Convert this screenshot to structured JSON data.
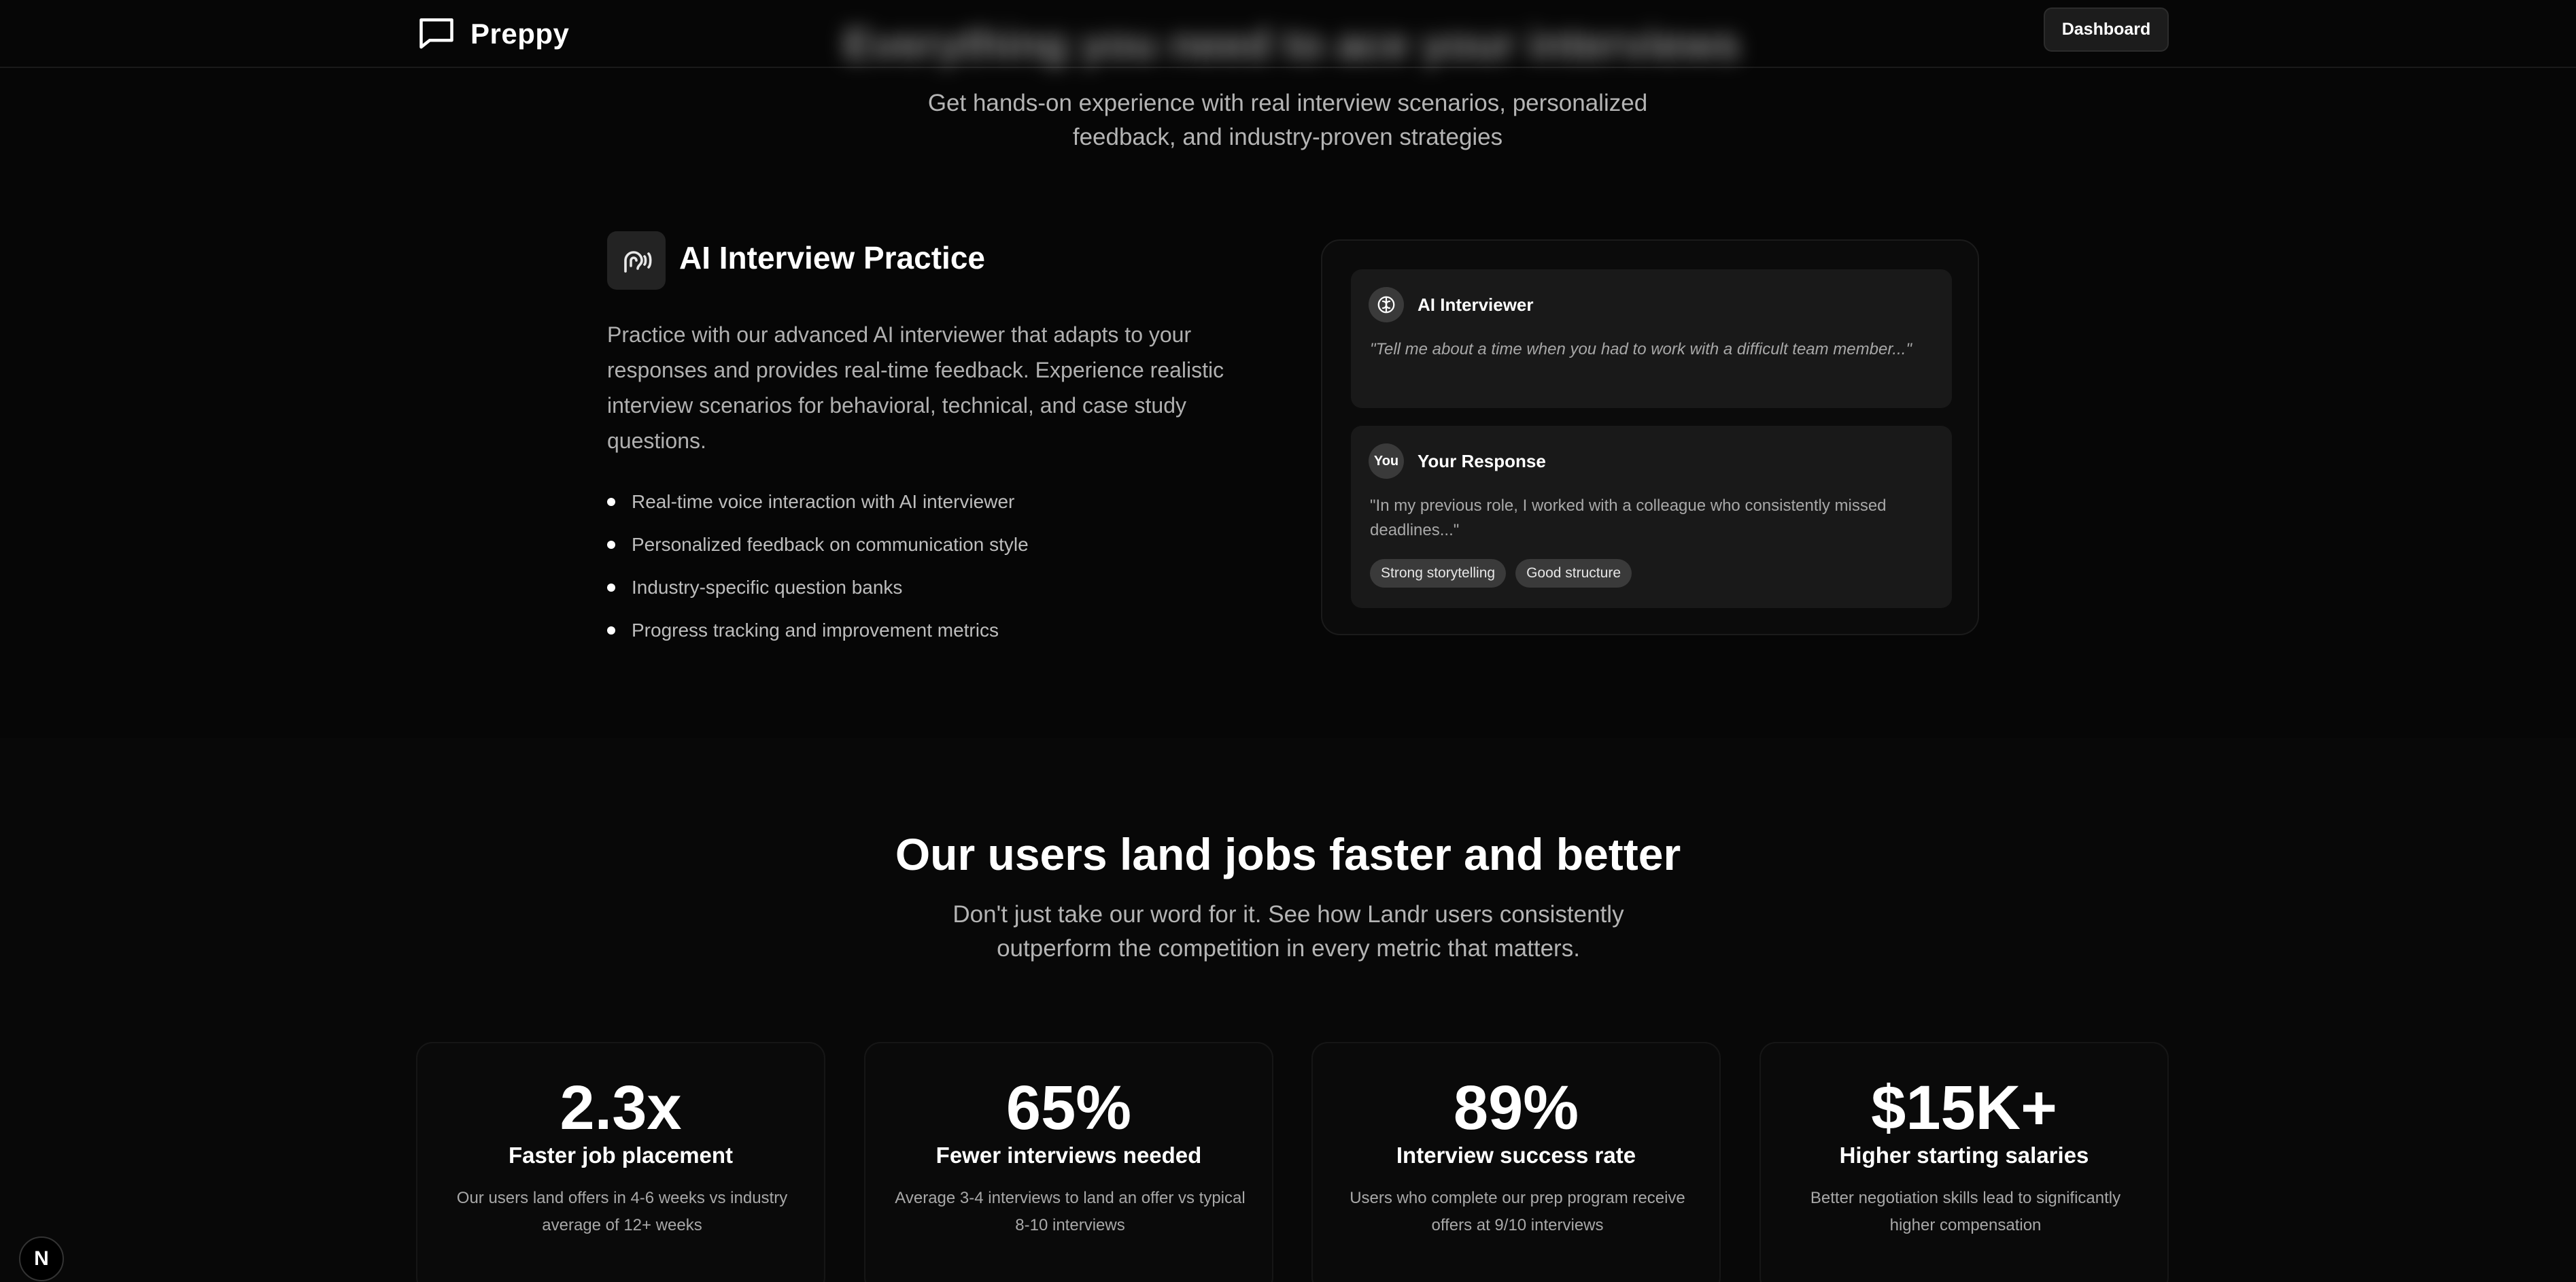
{
  "nav": {
    "brand": "Preppy",
    "blurred_heading": "Everything you need to ace your interviews",
    "dashboard_label": "Dashboard"
  },
  "hero": {
    "subtitle": "Get hands-on experience with real interview scenarios, personalized feedback, and industry-proven strategies"
  },
  "feature": {
    "icon": "voice-waveform-icon",
    "title": "AI Interview Practice",
    "description": "Practice with our advanced AI interviewer that adapts to your responses and provides real-time feedback. Experience realistic interview scenarios for behavioral, technical, and case study questions.",
    "bullets": [
      "Real-time voice interaction with AI interviewer",
      "Personalized feedback on communication style",
      "Industry-specific question banks",
      "Progress tracking and improvement metrics"
    ]
  },
  "demo": {
    "ai": {
      "avatar_icon": "brain-icon",
      "name": "AI Interviewer",
      "text": "\"Tell me about a time when you had to work with a difficult team member...\""
    },
    "you": {
      "avatar_label": "You",
      "name": "Your Response",
      "text": "\"In my previous role, I worked with a colleague who consistently missed deadlines...\"",
      "tags": [
        "Strong storytelling",
        "Good structure"
      ]
    }
  },
  "stats": {
    "title": "Our users land jobs faster and better",
    "subtitle": "Don't just take our word for it. See how Landr users consistently outperform the competition in every metric that matters.",
    "cards": [
      {
        "value": "2.3x",
        "label": "Faster job placement",
        "desc": "Our users land offers in 4-6 weeks vs industry average of 12+ weeks"
      },
      {
        "value": "65%",
        "label": "Fewer interviews needed",
        "desc": "Average 3-4 interviews to land an offer vs typical 8-10 interviews"
      },
      {
        "value": "89%",
        "label": "Interview success rate",
        "desc": "Users who complete our prep program receive offers at 9/10 interviews"
      },
      {
        "value": "$15K+",
        "label": "Higher starting salaries",
        "desc": "Better negotiation skills lead to significantly higher compensation"
      }
    ]
  },
  "badge": {
    "label": "N"
  }
}
